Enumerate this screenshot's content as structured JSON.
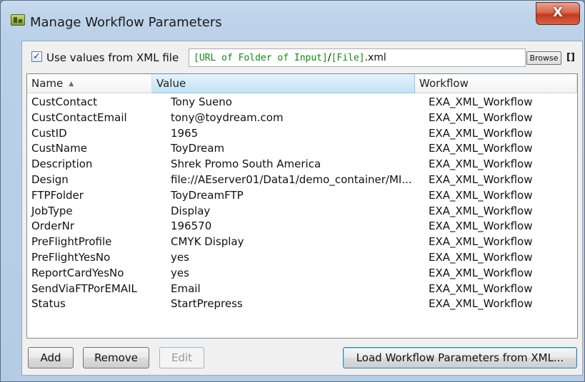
{
  "window": {
    "title": "Manage Workflow Parameters",
    "close_label": "X"
  },
  "xml_option": {
    "checked": true,
    "check_glyph": "✓",
    "label": "Use values from XML file",
    "path_tokens": {
      "token1": "[URL of Folder of Input]",
      "sep": "/",
      "token2": "[File]",
      "ext": ".xml"
    },
    "browse_label": "Browse",
    "brackets_label": "[]"
  },
  "table": {
    "columns": {
      "name": "Name",
      "value": "Value",
      "workflow": "Workflow"
    },
    "sort_icon": "▲",
    "rows": [
      {
        "name": "CustContact",
        "value": "Tony Sueno",
        "workflow": "EXA_XML_Workflow"
      },
      {
        "name": "CustContactEmail",
        "value": "tony@toydream.com",
        "workflow": "EXA_XML_Workflow"
      },
      {
        "name": "CustID",
        "value": "1965",
        "workflow": "EXA_XML_Workflow"
      },
      {
        "name": "CustName",
        "value": "ToyDream",
        "workflow": "EXA_XML_Workflow"
      },
      {
        "name": "Description",
        "value": "Shrek Promo South America",
        "workflow": "EXA_XML_Workflow"
      },
      {
        "name": "Design",
        "value": "file://AEserver01/Data1/demo_container/MI...",
        "workflow": "EXA_XML_Workflow"
      },
      {
        "name": "FTPFolder",
        "value": "ToyDreamFTP",
        "workflow": "EXA_XML_Workflow"
      },
      {
        "name": "JobType",
        "value": "Display",
        "workflow": "EXA_XML_Workflow"
      },
      {
        "name": "OrderNr",
        "value": "196570",
        "workflow": "EXA_XML_Workflow"
      },
      {
        "name": "PreFlightProfile",
        "value": "CMYK Display",
        "workflow": "EXA_XML_Workflow"
      },
      {
        "name": "PreFlightYesNo",
        "value": "yes",
        "workflow": "EXA_XML_Workflow"
      },
      {
        "name": "ReportCardYesNo",
        "value": "yes",
        "workflow": "EXA_XML_Workflow"
      },
      {
        "name": "SendViaFTPorEMAIL",
        "value": "Email",
        "workflow": "EXA_XML_Workflow"
      },
      {
        "name": "Status",
        "value": "StartPrepress",
        "workflow": "EXA_XML_Workflow"
      }
    ]
  },
  "buttons": {
    "add": "Add",
    "remove": "Remove",
    "edit": "Edit",
    "load": "Load Workflow Parameters from XML..."
  }
}
